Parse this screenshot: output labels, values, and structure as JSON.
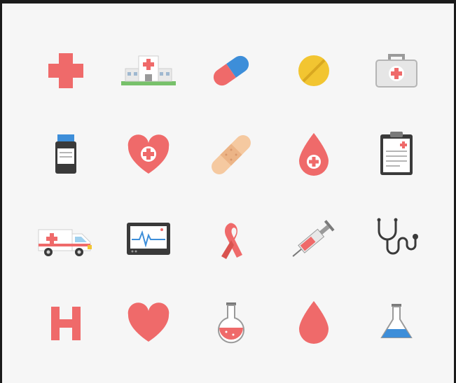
{
  "colors": {
    "background": "#f6f6f6",
    "frame": "#1b1b1b",
    "red": "#ef6a6a",
    "dark_red": "#d9534f",
    "blue": "#3d8ed9",
    "yellow": "#f2c531",
    "green": "#77c16a",
    "gray": "#cfcfcf",
    "dark": "#3a3a3a",
    "bandage": "#f5c9a0"
  },
  "icons": [
    {
      "row": 1,
      "name": "red-cross-icon"
    },
    {
      "row": 1,
      "name": "hospital-building-icon"
    },
    {
      "row": 1,
      "name": "capsule-pill-icon"
    },
    {
      "row": 1,
      "name": "tablet-pill-icon"
    },
    {
      "row": 1,
      "name": "first-aid-kit-icon"
    },
    {
      "row": 2,
      "name": "medicine-bottle-icon"
    },
    {
      "row": 2,
      "name": "heart-cross-icon"
    },
    {
      "row": 2,
      "name": "adhesive-bandage-icon"
    },
    {
      "row": 2,
      "name": "blood-drop-cross-icon"
    },
    {
      "row": 2,
      "name": "medical-clipboard-icon"
    },
    {
      "row": 3,
      "name": "ambulance-icon"
    },
    {
      "row": 3,
      "name": "heart-monitor-icon"
    },
    {
      "row": 3,
      "name": "awareness-ribbon-icon"
    },
    {
      "row": 3,
      "name": "syringe-icon"
    },
    {
      "row": 3,
      "name": "stethoscope-icon"
    },
    {
      "row": 4,
      "name": "hospital-h-icon"
    },
    {
      "row": 4,
      "name": "heart-icon"
    },
    {
      "row": 4,
      "name": "round-flask-icon"
    },
    {
      "row": 4,
      "name": "blood-drop-icon"
    },
    {
      "row": 4,
      "name": "erlenmeyer-flask-icon"
    }
  ]
}
